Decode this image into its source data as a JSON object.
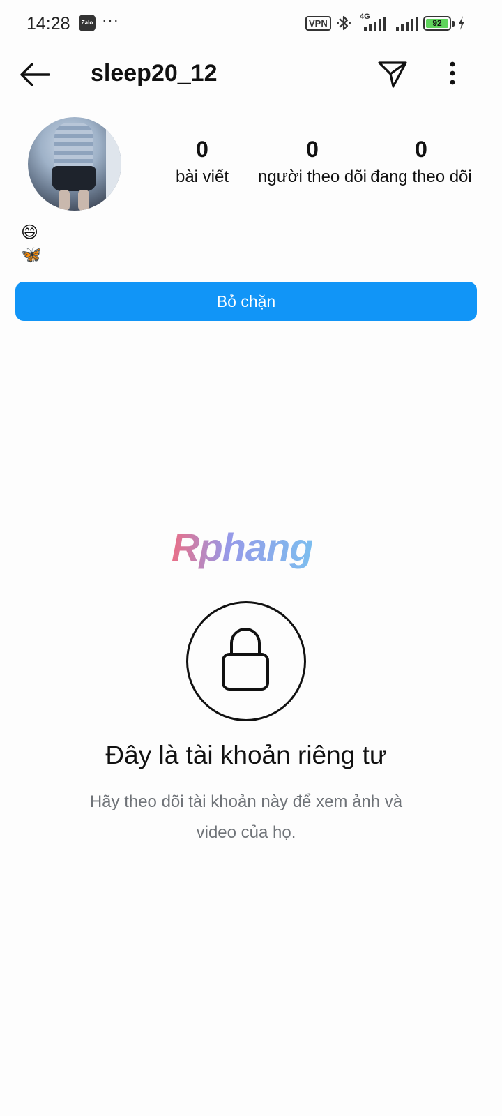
{
  "status_bar": {
    "time": "14:28",
    "notification_app": "Zalo",
    "more_notifications": "···",
    "vpn": "VPN",
    "network": "4G",
    "battery_level": "92"
  },
  "header": {
    "username": "sleep20_12"
  },
  "profile": {
    "stats": {
      "posts": {
        "count": "0",
        "label": "bài viết"
      },
      "followers": {
        "count": "0",
        "label": "người theo dõi"
      },
      "following": {
        "count": "0",
        "label": "đang theo dõi"
      }
    },
    "bio": [
      "😄",
      "🦋"
    ],
    "unblock_label": "Bỏ chặn"
  },
  "watermark": "Rphang",
  "private_notice": {
    "title": "Đây là tài khoản riêng tư",
    "description": "Hãy theo dõi tài khoản này để xem ảnh và video của họ."
  },
  "colors": {
    "accent": "#1195f7",
    "battery": "#5fd35c",
    "muted_text": "#6f7378"
  },
  "icons": [
    "back-arrow-icon",
    "send-icon",
    "more-vertical-icon",
    "lock-icon",
    "bluetooth-icon",
    "signal-icon",
    "battery-icon",
    "charging-icon"
  ]
}
